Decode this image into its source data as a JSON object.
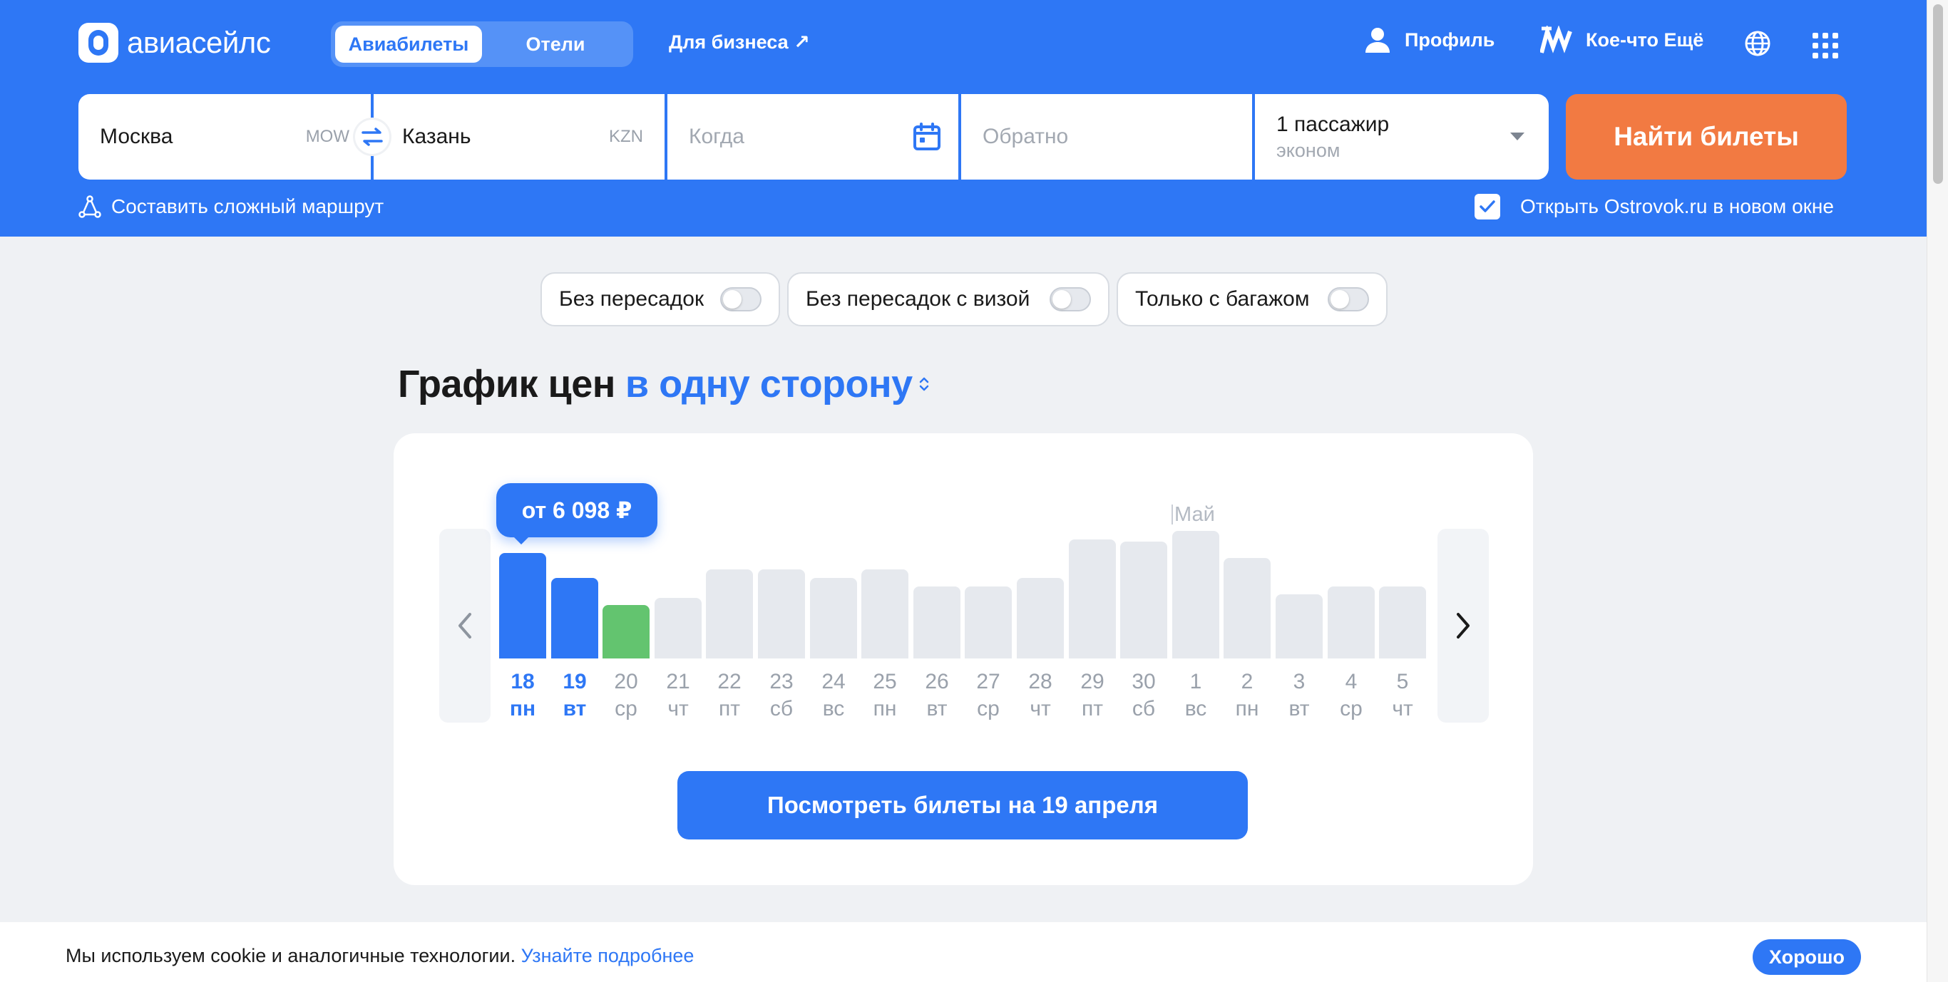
{
  "header": {
    "logo_text": "авиасейлс",
    "tabs": [
      {
        "label": "Авиабилеты",
        "active": true
      },
      {
        "label": "Отели",
        "active": false
      }
    ],
    "business_link": "Для бизнеса ↗",
    "profile_label": "Профиль",
    "more_label": "Кое-что Ещё"
  },
  "search": {
    "from": {
      "city": "Москва",
      "iata": "MOW"
    },
    "to": {
      "city": "Казань",
      "iata": "KZN"
    },
    "when_placeholder": "Когда",
    "return_placeholder": "Обратно",
    "passengers": "1 пассажир",
    "cabin_class": "эконом",
    "find_button": "Найти билеты",
    "complex_route": "Составить сложный маршрут",
    "ostrovok_label": "Открыть Ostrovok.ru в новом окне",
    "ostrovok_checked": true
  },
  "filters": [
    {
      "label": "Без пересадок",
      "on": false
    },
    {
      "label": "Без пересадок с визой",
      "on": false
    },
    {
      "label": "Только с багажом",
      "on": false
    }
  ],
  "chart": {
    "title": "График цен",
    "mode": "в одну сторону",
    "tooltip": "от 6 098 ₽",
    "month_label": "Май",
    "see_button": "Посмотреть билеты на 19 апреля"
  },
  "chart_data": {
    "type": "bar",
    "categories": [
      "18",
      "19",
      "20",
      "21",
      "22",
      "23",
      "24",
      "25",
      "26",
      "27",
      "28",
      "29",
      "30",
      "1",
      "2",
      "3",
      "4",
      "5"
    ],
    "weekdays": [
      "пн",
      "вт",
      "ср",
      "чт",
      "пт",
      "сб",
      "вс",
      "пн",
      "вт",
      "ср",
      "чт",
      "пт",
      "сб",
      "вс",
      "пн",
      "вт",
      "ср",
      "чт"
    ],
    "values": [
      85,
      65,
      43,
      49,
      72,
      72,
      65,
      72,
      58,
      58,
      65,
      96,
      94,
      103,
      81,
      52,
      58,
      58
    ],
    "selected": [
      "18",
      "19"
    ],
    "highlight_cheapest": "20",
    "colors": {
      "selected": "#2e77f5",
      "cheapest": "#63c46f",
      "default": "#e6e9ee"
    }
  },
  "cookie": {
    "text": "Мы используем cookie и аналогичные технологии.",
    "link": "Узнайте подробнее",
    "button": "Хорошо"
  }
}
